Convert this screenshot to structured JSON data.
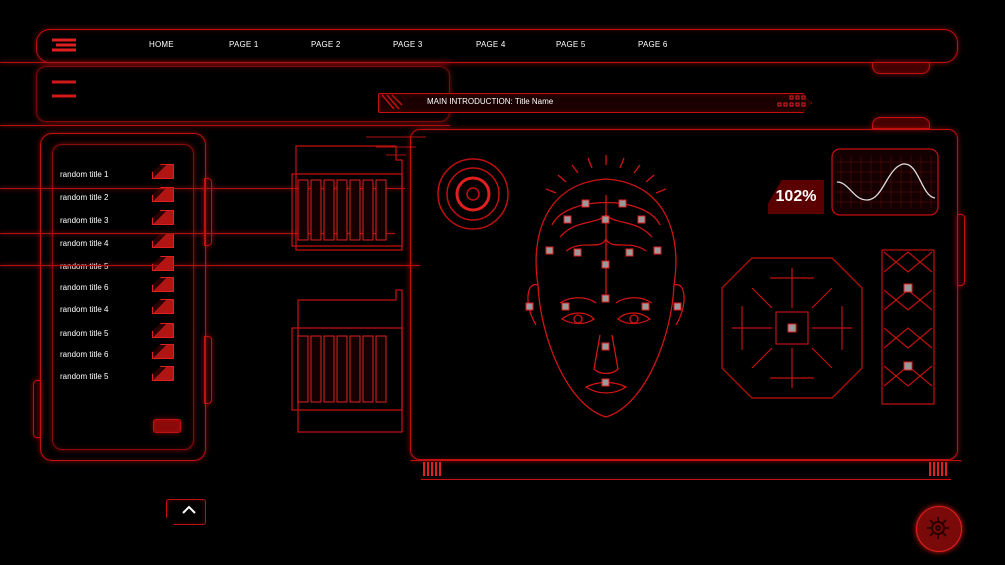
{
  "nav": {
    "items": [
      "HOME",
      "PAGE 1",
      "PAGE 2",
      "PAGE 3",
      "PAGE 4",
      "PAGE 5",
      "PAGE 6"
    ]
  },
  "header": {
    "title": "MAIN INTRODUCTION: Title Name"
  },
  "sidebar": {
    "items": [
      "random title 1",
      "random title 2",
      "random title 3",
      "random title 4",
      "random title 5",
      "random title 6",
      "random title 4",
      "random title 5",
      "random title 6",
      "random title 5"
    ]
  },
  "panel": {
    "percent": "102%"
  },
  "colors": {
    "background": "#000000",
    "accent": "#c01010",
    "glow": "#e01818",
    "text": "#ffffff"
  }
}
